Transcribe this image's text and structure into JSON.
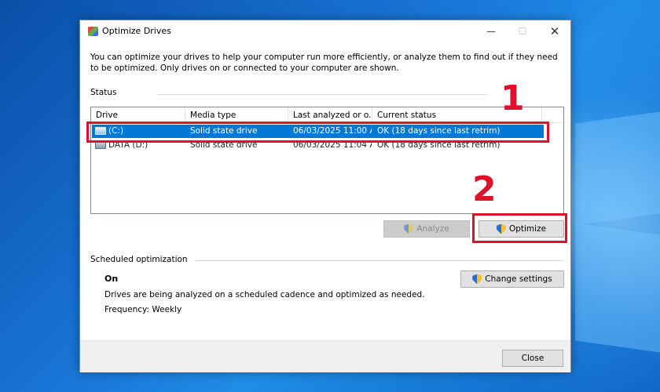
{
  "window": {
    "title": "Optimize Drives",
    "description": "You can optimize your drives to help your computer run more efficiently, or analyze them to find out if they need to be optimized. Only drives on or connected to your computer are shown.",
    "controls": {
      "minimize": "—",
      "maximize": "☐",
      "close": "✕"
    }
  },
  "status": {
    "label": "Status",
    "columns": [
      "Drive",
      "Media type",
      "Last analyzed or o...",
      "Current status"
    ],
    "drives": [
      {
        "drive": "(C:)",
        "media_type": "Solid state drive",
        "last_analyzed": "06/03/2025 11:00 A...",
        "current_status": "OK (18 days since last retrim)",
        "selected": true
      },
      {
        "drive": "DATA (D:)",
        "media_type": "Solid state drive",
        "last_analyzed": "06/03/2025 11:04 A...",
        "current_status": "OK (18 days since last retrim)",
        "selected": false
      }
    ],
    "analyze_label": "Analyze",
    "optimize_label": "Optimize"
  },
  "scheduled": {
    "label": "Scheduled optimization",
    "state": "On",
    "details": "Drives are being analyzed on a scheduled cadence and optimized as needed.",
    "frequency": "Frequency: Weekly",
    "change_settings_label": "Change settings"
  },
  "footer": {
    "close_label": "Close"
  },
  "annotations": {
    "step1": "1",
    "step2": "2"
  },
  "colors": {
    "selection": "#0078d7",
    "annotation": "#e0102a"
  }
}
